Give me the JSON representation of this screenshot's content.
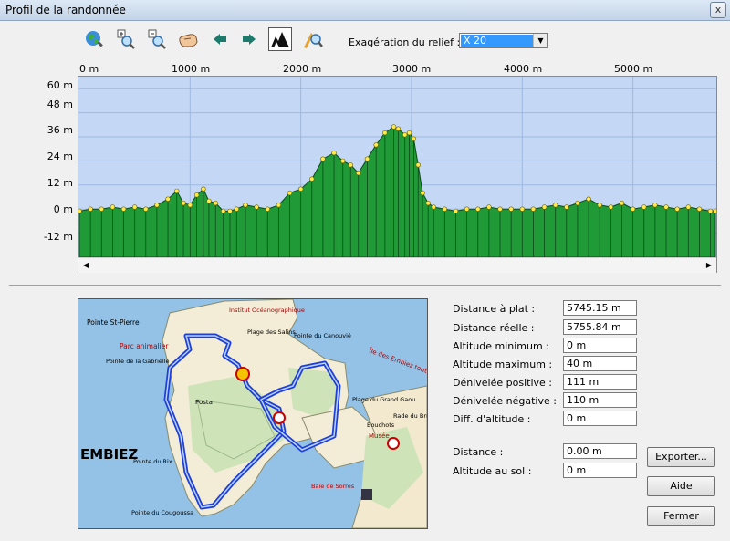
{
  "window": {
    "title": "Profil de la randonnée",
    "close_label": "x"
  },
  "toolbar": {
    "tools": [
      {
        "name": "globe-zoom-icon"
      },
      {
        "name": "zoom-in-icon"
      },
      {
        "name": "zoom-out-icon"
      },
      {
        "name": "pan-hand-icon"
      },
      {
        "name": "arrow-left-icon"
      },
      {
        "name": "arrow-right-icon"
      },
      {
        "name": "relief-profile-icon"
      },
      {
        "name": "measure-icon"
      }
    ],
    "exaggeration_label": "Exagération du relief :",
    "exaggeration_value": "X 20"
  },
  "chart_data": {
    "type": "area",
    "xlabel": "",
    "ylabel": "",
    "x_ticks": [
      "0 m",
      "1000 m",
      "2000 m",
      "3000 m",
      "4000 m",
      "5000 m"
    ],
    "y_ticks": [
      "60 m",
      "48 m",
      "36 m",
      "24 m",
      "12 m",
      "0 m",
      "-12 m"
    ],
    "xlim": [
      0,
      5745
    ],
    "ylim": [
      -24,
      66
    ],
    "grid": true,
    "colors": {
      "fill": "#1f9a37",
      "edge": "#0d4a18",
      "point": "#ffe94d",
      "background": "#c4d7f4",
      "grid": "#9fb8e0"
    },
    "x": [
      0,
      100,
      200,
      300,
      400,
      500,
      600,
      700,
      800,
      880,
      940,
      1000,
      1060,
      1120,
      1170,
      1230,
      1300,
      1360,
      1420,
      1500,
      1600,
      1700,
      1800,
      1900,
      2000,
      2100,
      2200,
      2300,
      2380,
      2450,
      2520,
      2600,
      2680,
      2760,
      2840,
      2880,
      2940,
      2980,
      3020,
      3060,
      3100,
      3150,
      3200,
      3300,
      3400,
      3500,
      3600,
      3700,
      3800,
      3900,
      4000,
      4100,
      4200,
      4300,
      4400,
      4500,
      4600,
      4700,
      4800,
      4900,
      5000,
      5100,
      5200,
      5300,
      5400,
      5500,
      5600,
      5700,
      5745
    ],
    "y": [
      -1,
      0,
      0,
      1,
      0,
      1,
      0,
      2,
      5,
      9,
      3,
      2,
      7,
      10,
      4,
      3,
      -1,
      -1,
      0,
      2,
      1,
      0,
      2,
      8,
      10,
      15,
      25,
      28,
      24,
      22,
      18,
      25,
      32,
      38,
      41,
      40,
      37,
      38,
      35,
      22,
      8,
      3,
      1,
      0,
      -1,
      0,
      0,
      1,
      0,
      0,
      0,
      0,
      1,
      2,
      1,
      3,
      5,
      2,
      1,
      3,
      0,
      1,
      2,
      1,
      0,
      1,
      0,
      -1,
      -1
    ]
  },
  "map": {
    "labels": [
      "Pointe St-Pierre",
      "Institut Océanographique",
      "Parc animalier",
      "Plage des Salins",
      "Pointe du Canouvié",
      "Pointe de la Gabrielle",
      "Posta",
      "Plage du Grand Gaou",
      "Bouchots",
      "Musée",
      "Île des Embiez toute l'année",
      "EMBIEZ",
      "Pointe du Rix",
      "Pointe du Cougoussa",
      "Rade du Brusc",
      "Baie de Sorres"
    ]
  },
  "stats": [
    {
      "label": "Distance à plat :",
      "value": "5745.15 m"
    },
    {
      "label": "Distance réelle :",
      "value": "5755.84 m"
    },
    {
      "label": "Altitude minimum :",
      "value": "0 m"
    },
    {
      "label": "Altitude maximum :",
      "value": "40 m"
    },
    {
      "label": "Dénivelée positive :",
      "value": "111 m"
    },
    {
      "label": "Dénivelée négative :",
      "value": "110 m"
    },
    {
      "label": "Diff. d'altitude :",
      "value": "0 m"
    }
  ],
  "cursor": [
    {
      "label": "Distance :",
      "value": "0.00 m"
    },
    {
      "label": "Altitude au sol :",
      "value": "0 m"
    }
  ],
  "buttons": {
    "export": "Exporter...",
    "help": "Aide",
    "close": "Fermer"
  }
}
